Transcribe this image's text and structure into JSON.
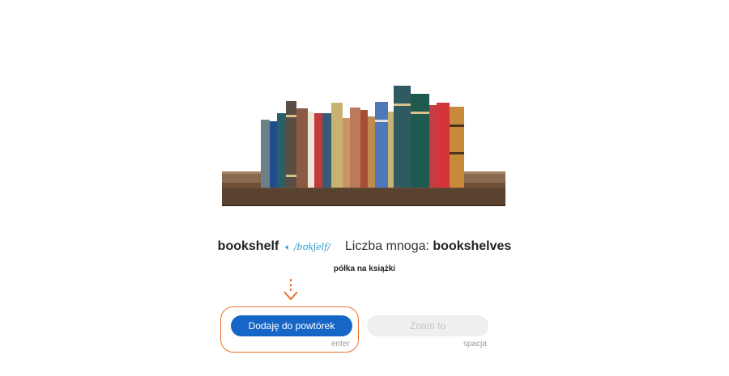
{
  "flashcard": {
    "word": "bookshelf",
    "speaker_icon": "speaker-icon",
    "pronunciation": "/bʊkʃelf/",
    "plural_label": "Liczba mnoga:",
    "plural_value": "bookshelves",
    "translation": "półka na książki"
  },
  "actions": {
    "add_to_review_label": "Dodaję do powtórek",
    "add_to_review_hint": "enter",
    "know_it_label": "Znam to",
    "know_it_hint": "spacja"
  },
  "colors": {
    "primary": "#1566c6",
    "accent": "#e8722a",
    "pronunciation": "#2c9bd0",
    "disabled_bg": "#efefef"
  }
}
